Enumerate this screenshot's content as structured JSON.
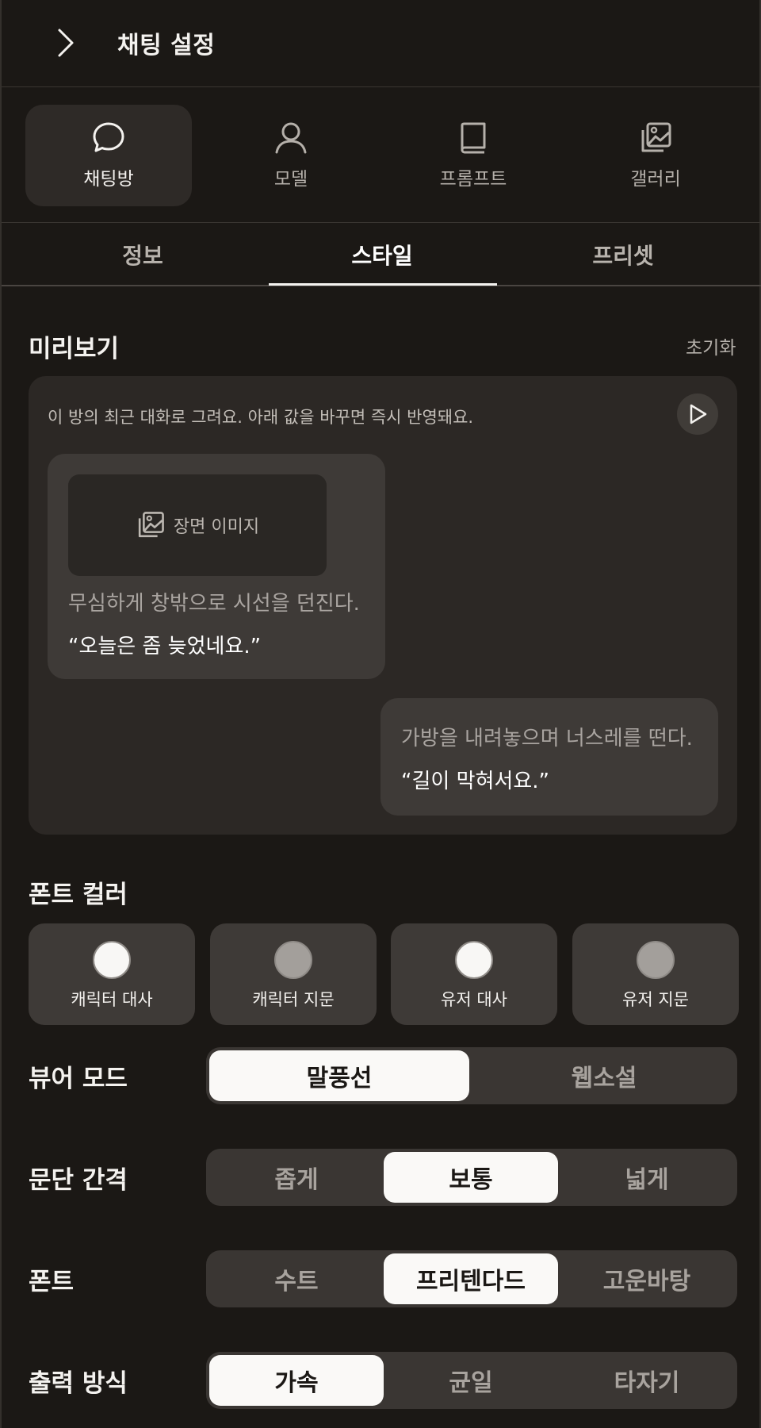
{
  "header": {
    "title": "채팅 설정"
  },
  "category_tabs": [
    {
      "label": "채팅방",
      "icon": "chat-bubble-icon",
      "active": true
    },
    {
      "label": "모델",
      "icon": "person-icon",
      "active": false
    },
    {
      "label": "프롬프트",
      "icon": "book-icon",
      "active": false
    },
    {
      "label": "갤러리",
      "icon": "gallery-icon",
      "active": false
    }
  ],
  "sub_tabs": [
    {
      "label": "정보",
      "active": false
    },
    {
      "label": "스타일",
      "active": true
    },
    {
      "label": "프리셋",
      "active": false
    }
  ],
  "preview": {
    "title": "미리보기",
    "reset_label": "초기화",
    "hint": "이 방의 최근 대화로 그려요. 아래 값을 바꾸면 즉시 반영돼요.",
    "scene_image_label": "장면 이미지",
    "character_narration": "무심하게 창밖으로 시선을 던진다.",
    "character_dialogue": "“오늘은 좀 늦었네요.”",
    "user_narration": "가방을 내려놓으며 너스레를 떤다.",
    "user_dialogue": "“길이 막혀서요.”"
  },
  "font_color": {
    "title": "폰트 컬러",
    "items": [
      {
        "label": "캐릭터 대사",
        "color": "#f8f7f5"
      },
      {
        "label": "캐릭터 지문",
        "color": "#a39f9b"
      },
      {
        "label": "유저 대사",
        "color": "#f8f7f5"
      },
      {
        "label": "유저 지문",
        "color": "#a39f9b"
      }
    ]
  },
  "viewer_mode": {
    "label": "뷰어 모드",
    "options": [
      "말풍선",
      "웹소설"
    ],
    "selected": "말풍선"
  },
  "paragraph_spacing": {
    "label": "문단 간격",
    "options": [
      "좁게",
      "보통",
      "넓게"
    ],
    "selected": "보통"
  },
  "font": {
    "label": "폰트",
    "options": [
      "수트",
      "프리텐다드",
      "고운바탕"
    ],
    "selected": "프리텐다드"
  },
  "output_mode": {
    "label": "출력 방식",
    "options": [
      "가속",
      "균일",
      "타자기"
    ],
    "selected": "가속"
  },
  "colors": {
    "background": "#1b1815",
    "active_segment": "#faf9f7"
  }
}
